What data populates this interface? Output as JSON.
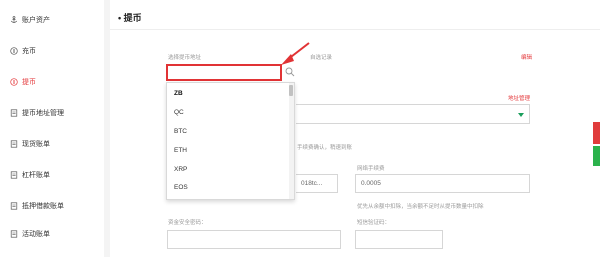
{
  "sidebar": {
    "items": [
      {
        "label": "账户资产",
        "icon": "anchor-icon"
      },
      {
        "label": "充币",
        "icon": "coin-icon"
      },
      {
        "label": "提币",
        "icon": "coin-icon",
        "active": true
      },
      {
        "label": "提币地址管理",
        "icon": "document-icon"
      },
      {
        "label": "现货账单",
        "icon": "document-icon"
      },
      {
        "label": "杠杆账单",
        "icon": "document-icon"
      },
      {
        "label": "抵押借款账单",
        "icon": "document-icon"
      },
      {
        "label": "活动账单",
        "icon": "document-icon"
      }
    ]
  },
  "header": {
    "title": "提币"
  },
  "form": {
    "currency_label": "选择提币地址",
    "currency_value": "",
    "history_label": "自选记录",
    "edit_link": "编辑",
    "address_manage_link": "地址管理",
    "confirm_note": "手续费确认，稍速到账",
    "amount_fragment": "018tc...",
    "fee_label": "网络手续费",
    "fee_value": "0.0005",
    "fee_note": "优先从余额中扣除，当余额不足时从提币数量中扣除",
    "fund_password_label": "资金安全密码：",
    "sms_label": "短信验证码："
  },
  "dropdown": {
    "options": [
      "ZB",
      "QC",
      "BTC",
      "ETH",
      "XRP",
      "EOS"
    ],
    "highlighted": "ZB"
  },
  "colors": {
    "accent_red": "#e4393c",
    "highlight_border": "#e13335",
    "caret_green": "#1a9e5b",
    "side_bar_red": "#e03c3c",
    "side_bar_green": "#2bb24c"
  }
}
